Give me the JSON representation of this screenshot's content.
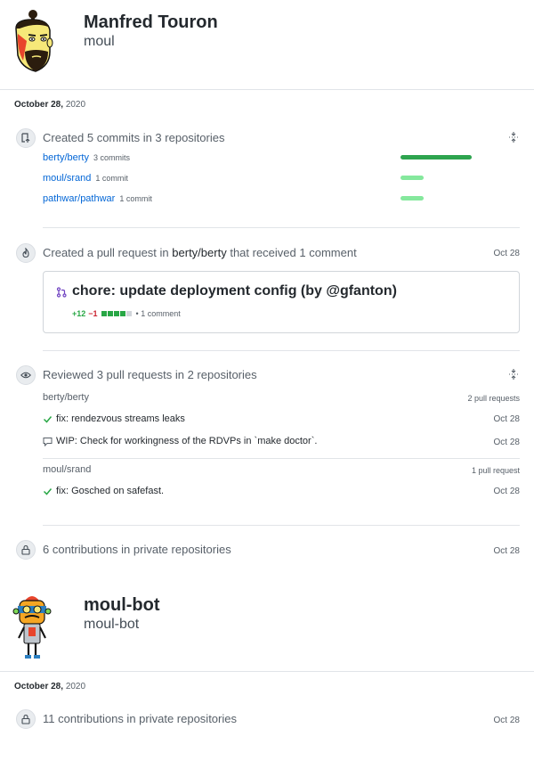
{
  "profiles": [
    {
      "name": "Manfred Touron",
      "login": "moul"
    },
    {
      "name": "moul-bot",
      "login": "moul-bot"
    }
  ],
  "sections": [
    {
      "date_bold": "October 28,",
      "date_year": "2020"
    },
    {
      "date_bold": "October 28,",
      "date_year": "2020"
    }
  ],
  "commits": {
    "title": "Created 5 commits in 3 repositories",
    "icon": "repo-push-icon",
    "repos": [
      {
        "repo": "berty/berty",
        "count": "3 commits",
        "share": 1.0,
        "color": "#2ea44f"
      },
      {
        "repo": "moul/srand",
        "count": "1 commit",
        "share": 0.33,
        "color": "#85e89d"
      },
      {
        "repo": "pathwar/pathwar",
        "count": "1 commit",
        "share": 0.33,
        "color": "#85e89d"
      }
    ]
  },
  "pull_request": {
    "title_prefix": "Created a pull request in",
    "title_repo": "berty/berty",
    "title_suffix": "that received 1 comment",
    "date": "Oct 28",
    "icon": "flame-icon",
    "card": {
      "title": "chore: update deployment config (by @gfanton)",
      "additions": "+12",
      "deletions": "−1",
      "diff_blocks": [
        "add",
        "add",
        "add",
        "add",
        "neutral"
      ],
      "comments": "• 1 comment"
    }
  },
  "reviews": {
    "title": "Reviewed 3 pull requests in 2 repositories",
    "icon": "eye-icon",
    "groups": [
      {
        "repo": "berty/berty",
        "count": "2 pull requests",
        "items": [
          {
            "icon": "check-icon",
            "title": "fix: rendezvous streams leaks",
            "date": "Oct 28"
          },
          {
            "icon": "comment-icon",
            "title": "WIP: Check for workingness of the RDVPs in `make doctor`.",
            "date": "Oct 28"
          }
        ]
      },
      {
        "repo": "moul/srand",
        "count": "1 pull request",
        "items": [
          {
            "icon": "check-icon",
            "title": "fix: Gosched on safefast.",
            "date": "Oct 28"
          }
        ]
      }
    ]
  },
  "private1": {
    "title": "6 contributions in private repositories",
    "date": "Oct 28",
    "icon": "lock-icon"
  },
  "private2": {
    "title": "11 contributions in private repositories",
    "date": "Oct 28",
    "icon": "lock-icon"
  },
  "colors": {
    "link": "#0366d6",
    "add": "#28a745",
    "delete": "#cb2431",
    "pr_open": "#6f42c1"
  }
}
